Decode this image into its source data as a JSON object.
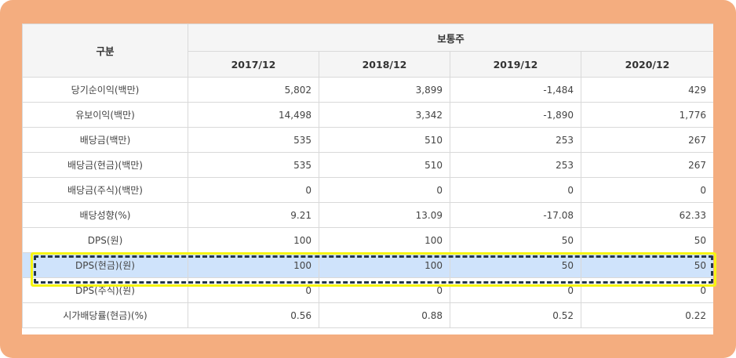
{
  "table": {
    "corner_header": "구분",
    "group_header": "보통주",
    "year_headers": [
      "2017/12",
      "2018/12",
      "2019/12",
      "2020/12"
    ],
    "rows": [
      {
        "label": "당기순이익(백만)",
        "values": [
          "5,802",
          "3,899",
          "-1,484",
          "429"
        ]
      },
      {
        "label": "유보이익(백만)",
        "values": [
          "14,498",
          "3,342",
          "-1,890",
          "1,776"
        ]
      },
      {
        "label": "배당금(백만)",
        "values": [
          "535",
          "510",
          "253",
          "267"
        ]
      },
      {
        "label": "배당금(현금)(백만)",
        "values": [
          "535",
          "510",
          "253",
          "267"
        ]
      },
      {
        "label": "배당금(주식)(백만)",
        "values": [
          "0",
          "0",
          "0",
          "0"
        ]
      },
      {
        "label": "배당성향(%)",
        "values": [
          "9.21",
          "13.09",
          "-17.08",
          "62.33"
        ]
      },
      {
        "label": "DPS(원)",
        "values": [
          "100",
          "100",
          "50",
          "50"
        ]
      },
      {
        "label": "DPS(현금)(원)",
        "values": [
          "100",
          "100",
          "50",
          "50"
        ]
      },
      {
        "label": "DPS(주식)(원)",
        "values": [
          "0",
          "0",
          "0",
          "0"
        ]
      },
      {
        "label": "시가배당률(현금)(%)",
        "values": [
          "0.56",
          "0.88",
          "0.52",
          "0.22"
        ]
      }
    ],
    "highlighted_row": 7
  },
  "colors": {
    "frame": "#f4ad7f",
    "header_bg": "#f5f5f5",
    "highlight_row": "#cfe3fb",
    "highlight_outline": "#f6f510",
    "highlight_dash": "#23364a"
  }
}
